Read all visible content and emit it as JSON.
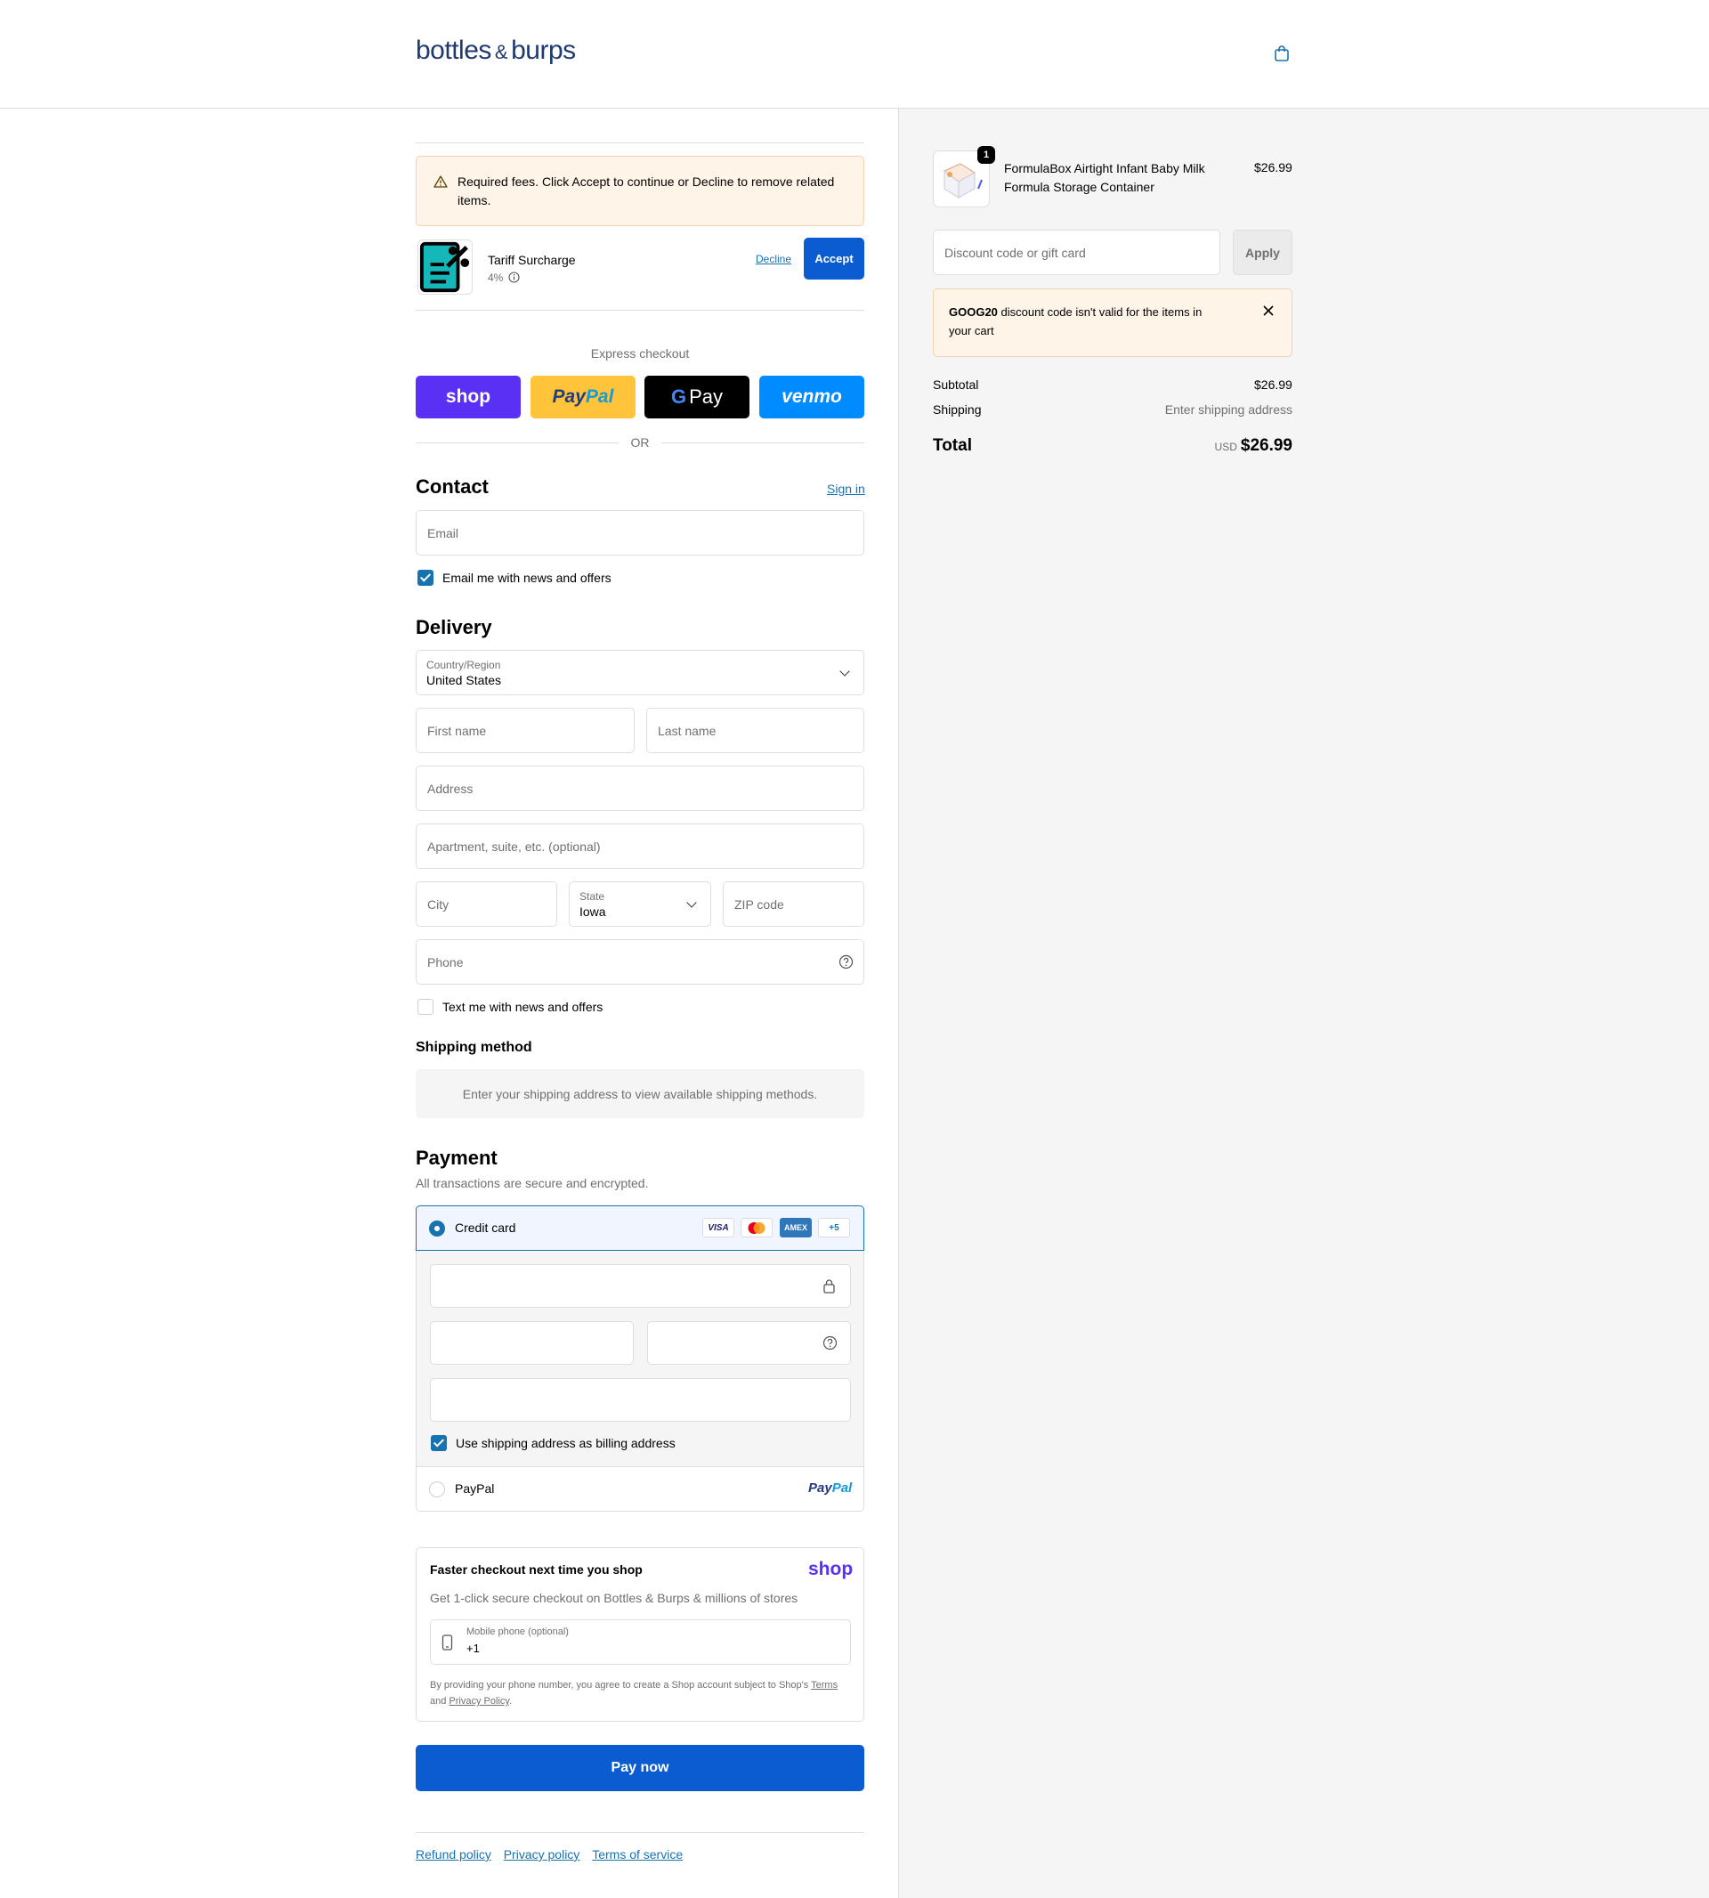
{
  "header": {
    "logo_main": "bottles",
    "logo_amp": "&",
    "logo_end": "burps",
    "cart_icon": "shopping-bag-icon"
  },
  "fees": {
    "notice": "Required fees. Click Accept to continue or Decline to remove related items.",
    "item_name": "Tariff Surcharge",
    "item_rate": "4%",
    "decline_label": "Decline",
    "accept_label": "Accept"
  },
  "express": {
    "title": "Express checkout",
    "shop_label": "shop",
    "paypal_label_a": "Pay",
    "paypal_label_b": "Pal",
    "gpay_label_g": "G",
    "gpay_label": "Pay",
    "venmo_label": "venmo",
    "or_label": "OR"
  },
  "contact": {
    "heading": "Contact",
    "signin_label": "Sign in",
    "email_placeholder": "Email",
    "news_label": "Email me with news and offers"
  },
  "delivery": {
    "heading": "Delivery",
    "country_label": "Country/Region",
    "country_value": "United States",
    "first_name": "First name",
    "last_name": "Last name",
    "address": "Address",
    "apartment": "Apartment, suite, etc. (optional)",
    "city": "City",
    "state_label": "State",
    "state_value": "Iowa",
    "zip": "ZIP code",
    "phone": "Phone",
    "text_label": "Text me with news and offers"
  },
  "shipping": {
    "heading": "Shipping method",
    "notice": "Enter your shipping address to view available shipping methods."
  },
  "payment": {
    "heading": "Payment",
    "subtitle": "All transactions are secure and encrypted.",
    "credit_card_label": "Credit card",
    "card_visa": "VISA",
    "card_amex": "AMEX",
    "card_more": "+5",
    "billing_label": "Use shipping address as billing address",
    "paypal_label": "PayPal",
    "paypal_logo_a": "Pay",
    "paypal_logo_b": "Pal"
  },
  "shop_pay": {
    "title": "Faster checkout next time you shop",
    "logo": "shop",
    "subtitle": "Get 1-click secure checkout on Bottles & Burps & millions of stores",
    "phone_label": "Mobile phone (optional)",
    "phone_value": "+1",
    "legal_a": "By providing your phone number, you agree to create a Shop account subject to Shop's",
    "terms": "Terms",
    "legal_and": "and",
    "privacy": "Privacy Policy",
    "legal_end": "."
  },
  "pay_now_label": "Pay now",
  "footer": {
    "refund": "Refund policy",
    "privacy": "Privacy policy",
    "terms": "Terms of service"
  },
  "summary": {
    "product_name_1": "FormulaBox Airtight Infant Baby Milk",
    "product_name_2": "Formula Storage Container",
    "product_price": "$26.99",
    "quantity": "1",
    "discount_placeholder": "Discount code or gift card",
    "apply_label": "Apply",
    "error_code": "GOOG20",
    "error_rest_1": " discount code isn't valid for the items in",
    "error_rest_2": "your cart",
    "subtotal_label": "Subtotal",
    "subtotal_value": "$26.99",
    "shipping_label": "Shipping",
    "shipping_value": "Enter shipping address",
    "total_label": "Total",
    "total_currency": "USD",
    "total_value": "$26.99"
  },
  "colors": {
    "accent": "#0a5cd0",
    "link": "#1773b0",
    "shop_purple": "#5a31f4",
    "paypal_yellow": "#ffc439",
    "venmo_blue": "#008cff",
    "warn_bg": "#fff4e8"
  }
}
